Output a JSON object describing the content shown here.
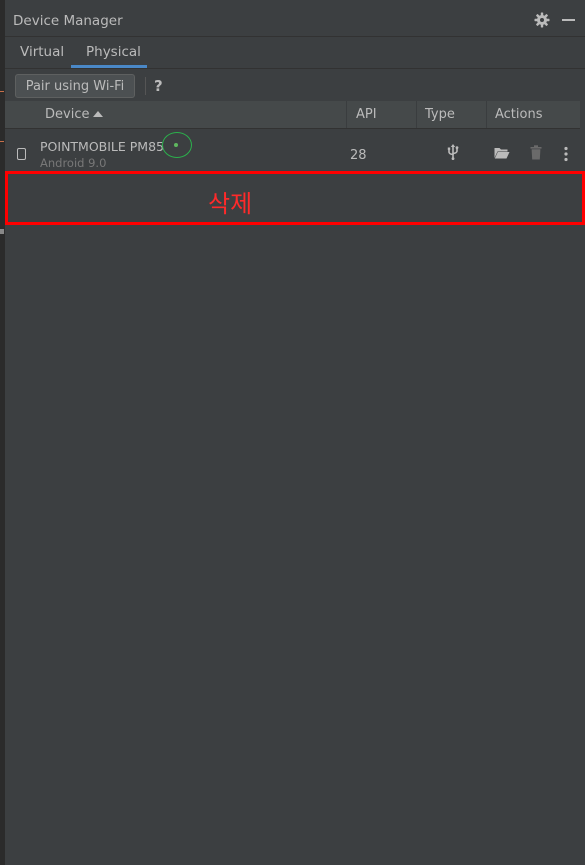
{
  "window": {
    "title": "Device Manager"
  },
  "tabs": [
    {
      "label": "Virtual",
      "selected": false
    },
    {
      "label": "Physical",
      "selected": true
    }
  ],
  "toolbar": {
    "pair_label": "Pair using Wi-Fi",
    "help_label": "?"
  },
  "table": {
    "columns": {
      "device": "Device",
      "api": "API",
      "type": "Type",
      "actions": "Actions"
    },
    "sort": {
      "column": "Device",
      "direction": "ascending"
    },
    "rows": [
      {
        "name": "POINTMOBILE PM85",
        "os": "Android 9.0",
        "api": "28",
        "status": "online",
        "connection": "usb-icon"
      }
    ]
  },
  "annotation": {
    "label": "삭제",
    "color": "#ff0000"
  },
  "colors": {
    "background": "#3c3f41",
    "accent": "#4a88c7",
    "online": "#2bb14c"
  }
}
